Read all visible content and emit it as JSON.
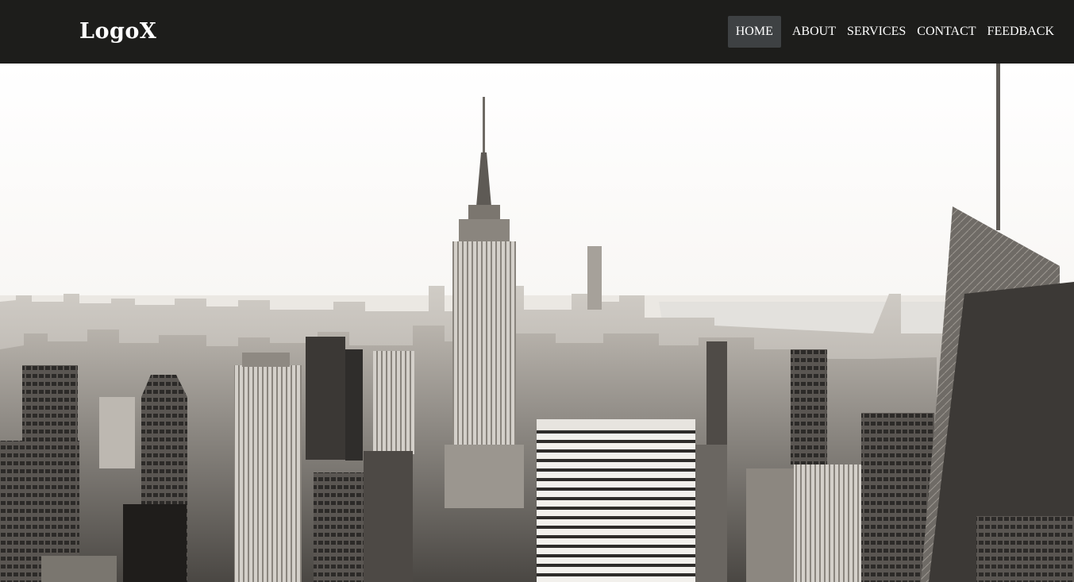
{
  "brand": {
    "logo_text": "LogoX"
  },
  "nav": {
    "items": [
      {
        "label": "HOME",
        "active": true
      },
      {
        "label": "ABOUT",
        "active": false
      },
      {
        "label": "SERVICES",
        "active": false
      },
      {
        "label": "CONTACT",
        "active": false
      },
      {
        "label": "FEEDBACK",
        "active": false
      }
    ]
  },
  "colors": {
    "navbar_bg": "#1d1d1b",
    "active_item_bg": "#3e4143",
    "text": "#ffffff"
  },
  "hero": {
    "image_subject": "black-and-white city skyline photo"
  }
}
